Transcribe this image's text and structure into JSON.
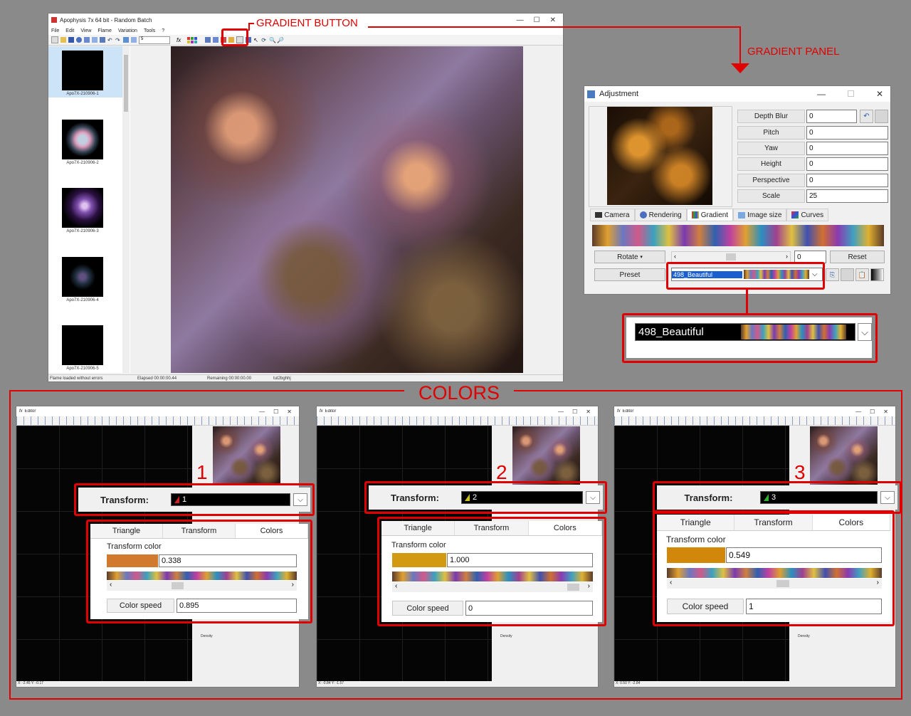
{
  "annotations": {
    "gradient_button": "GRADIENT BUTTON",
    "gradient_panel": "GRADIENT PANEL",
    "colors": "COLORS",
    "step1": "1",
    "step2": "2",
    "step3": "3"
  },
  "main_window": {
    "title": "Apophysis 7x 64 bit - Random Batch",
    "menu": [
      "File",
      "Edit",
      "View",
      "Flame",
      "Variation",
      "Tools",
      "?"
    ],
    "batch_count": "5",
    "thumbnails": [
      "Apo7X-210906-1",
      "Apo7X-210906-2",
      "Apo7X-210906-3",
      "Apo7X-210906-4",
      "Apo7X-210906-5"
    ],
    "status": {
      "message": "Flame loaded without errors",
      "elapsed": "Elapsed 00:00:00.44",
      "remaining": "Remaining 00:00:00.00",
      "name": "tut2bghhj"
    }
  },
  "adjustment": {
    "title": "Adjustment",
    "fields": [
      {
        "label": "Depth Blur",
        "value": "0"
      },
      {
        "label": "Pitch",
        "value": "0"
      },
      {
        "label": "Yaw",
        "value": "0"
      },
      {
        "label": "Height",
        "value": "0"
      },
      {
        "label": "Perspective",
        "value": "0"
      },
      {
        "label": "Scale",
        "value": "25"
      }
    ],
    "tabs": [
      "Camera",
      "Rendering",
      "Gradient",
      "Image size",
      "Curves"
    ],
    "rotate_label": "Rotate",
    "rotate_value": "0",
    "reset_label": "Reset",
    "preset_label": "Preset",
    "preset_value": "498_Beautiful"
  },
  "zoom_preset": "498_Beautiful",
  "editors": [
    {
      "title": "Editor",
      "transform_label": "Transform:",
      "transform_value": "1",
      "tabs": [
        "Triangle",
        "Transform",
        "Colors"
      ],
      "transform_color_label": "Transform color",
      "transform_color_value": "0.338",
      "swatch": "#d17a2e",
      "color_speed_label": "Color speed",
      "color_speed_value": "0.895",
      "coords": "X: -2.45    Y: -0.17",
      "density": "Density"
    },
    {
      "title": "Editor",
      "transform_label": "Transform:",
      "transform_value": "2",
      "tabs": [
        "Triangle",
        "Transform",
        "Colors"
      ],
      "transform_color_label": "Transform color",
      "transform_color_value": "1.000",
      "swatch": "#d19a12",
      "color_speed_label": "Color speed",
      "color_speed_value": "0",
      "coords": "X: -0.84    Y: -1.57",
      "density": "Density"
    },
    {
      "title": "Editor",
      "transform_label": "Transform:",
      "transform_value": "3",
      "tabs": [
        "Triangle",
        "Transform",
        "Colors"
      ],
      "transform_color_label": "Transform color",
      "transform_color_value": "0.549",
      "swatch": "#d1880a",
      "color_speed_label": "Color speed",
      "color_speed_value": "1",
      "coords": "X: 0.50    Y: -2.84",
      "density": "Density"
    }
  ]
}
